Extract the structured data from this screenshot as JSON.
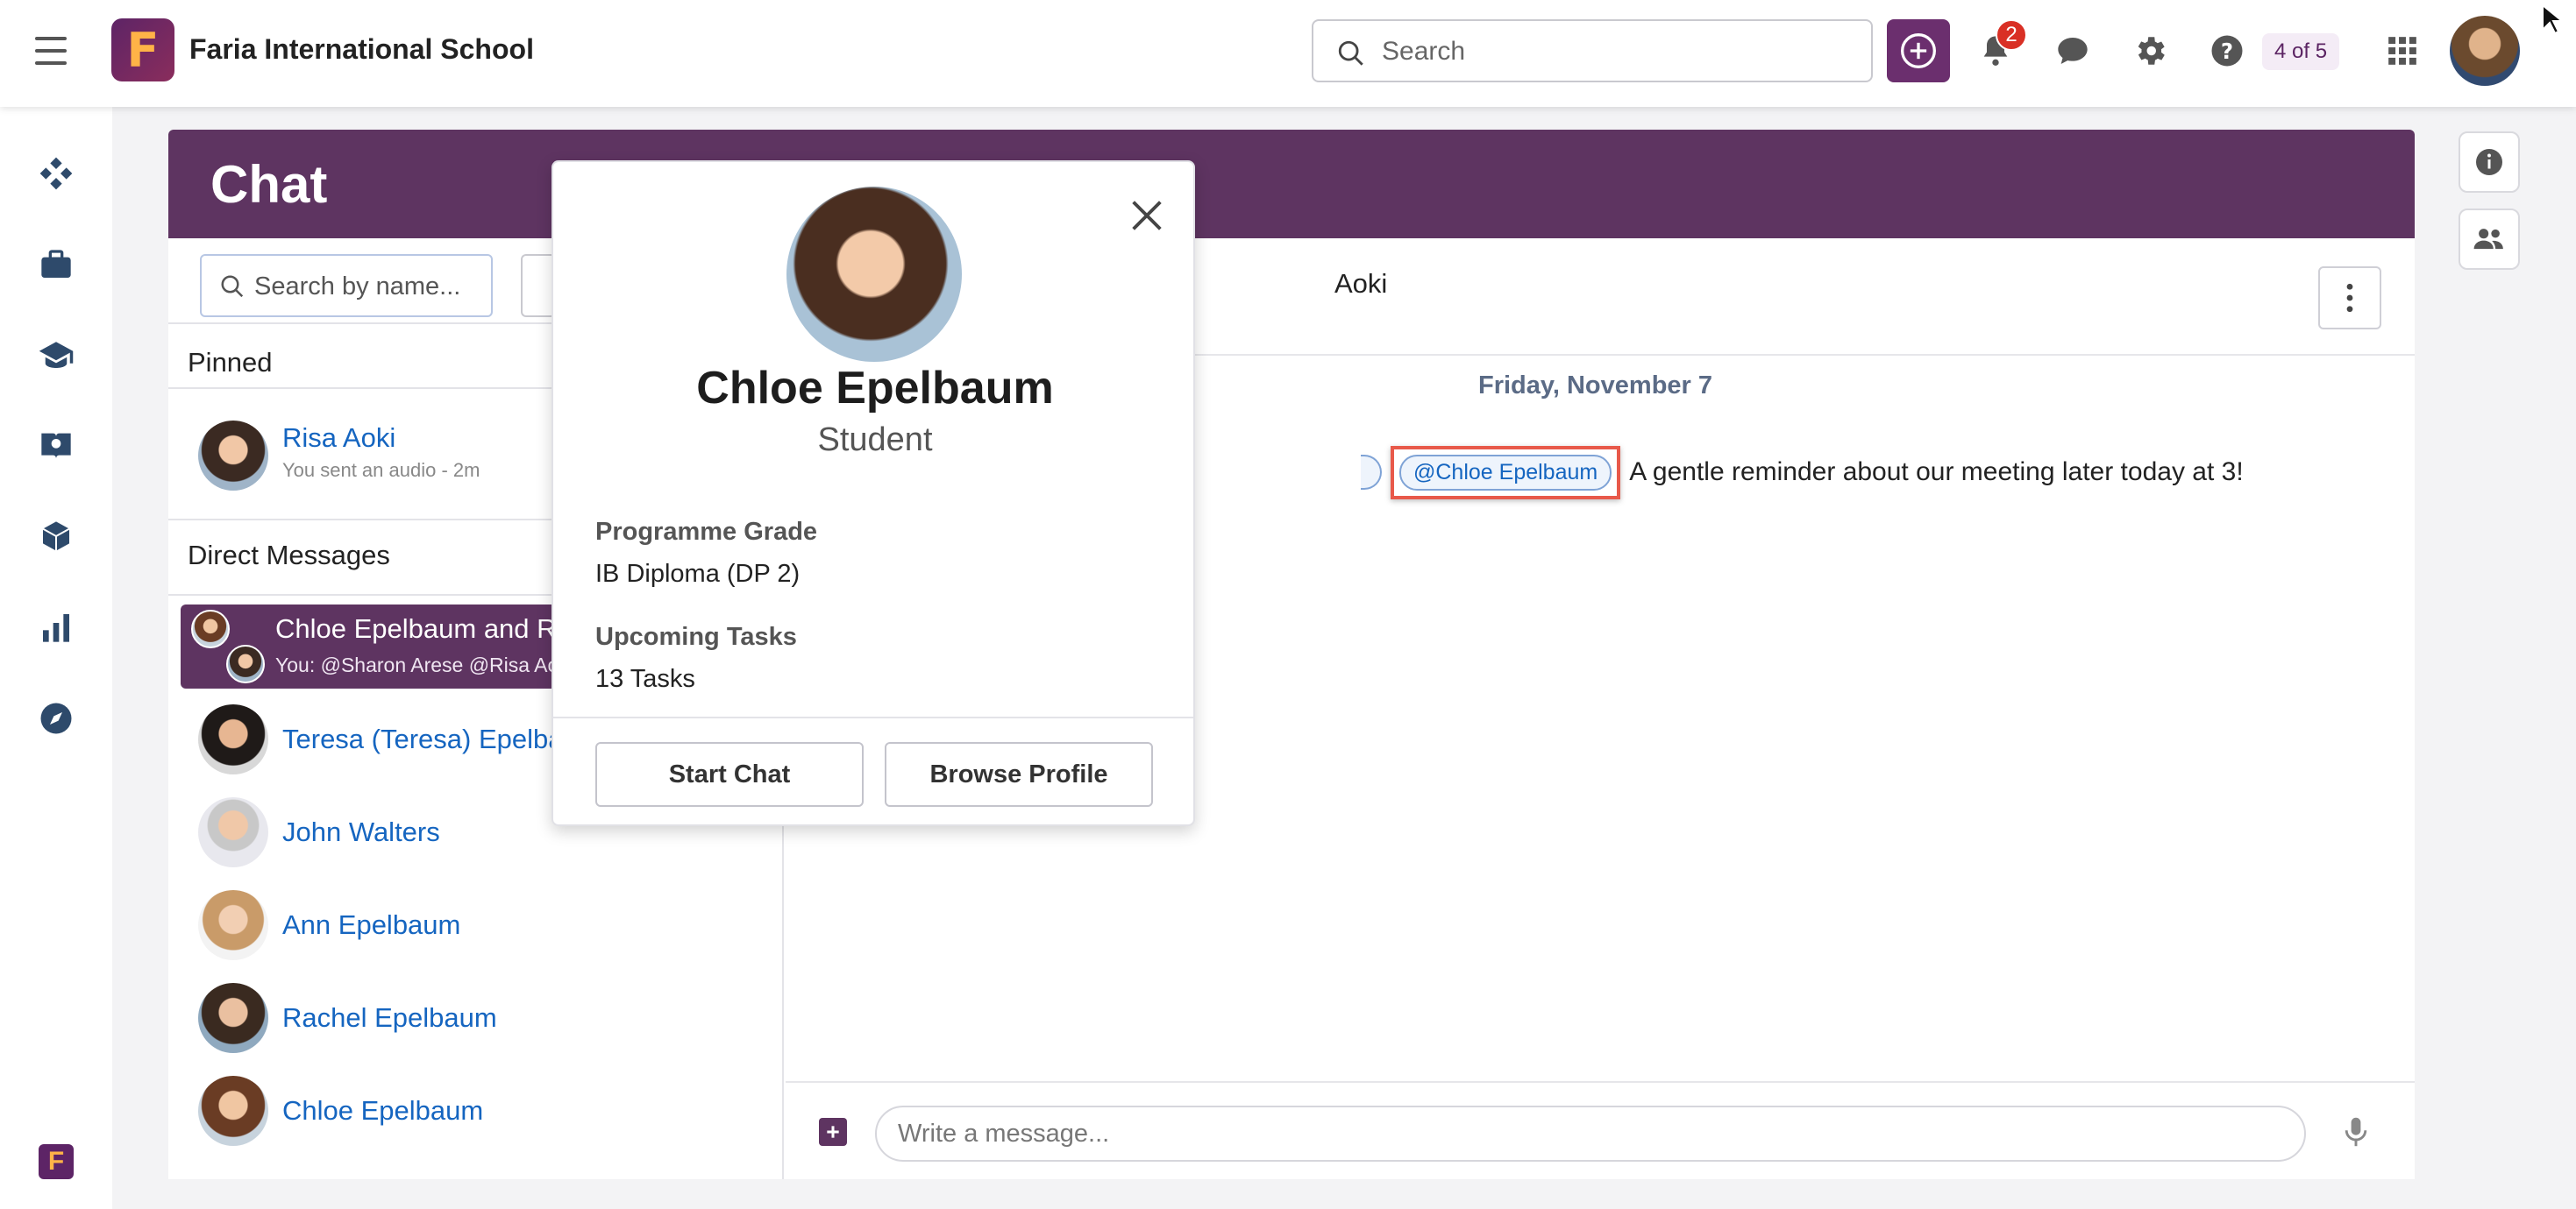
{
  "app": {
    "school_name": "Faria International School",
    "logo_letter": "F"
  },
  "topbar": {
    "search_placeholder": "Search",
    "notification_count": "2",
    "pager": "4 of 5"
  },
  "chat": {
    "title": "Chat",
    "search_placeholder": "Search by name...",
    "pinned_title": "Pinned",
    "pinned": [
      {
        "name": "Risa Aoki",
        "preview": "You sent an audio",
        "time": "- 2m"
      }
    ],
    "dm_title": "Direct Messages",
    "active": {
      "name": "Chloe Epelbaum and R",
      "preview": "You: @Sharon Arese @Risa Ao"
    },
    "contacts": [
      {
        "name": "Teresa (Teresa) Epelba"
      },
      {
        "name": "John Walters"
      },
      {
        "name": "Ann Epelbaum"
      },
      {
        "name": "Rachel Epelbaum"
      },
      {
        "name": "Chloe Epelbaum"
      }
    ]
  },
  "conversation": {
    "header_name": "Aoki",
    "date": "Friday, November 7",
    "mention": "@Chloe Epelbaum",
    "message": "A gentle reminder about our meeting later today at 3!",
    "composer_placeholder": "Write a message..."
  },
  "profile": {
    "name": "Chloe Epelbaum",
    "role": "Student",
    "grade_label": "Programme Grade",
    "grade_value": "IB Diploma (DP 2)",
    "tasks_label": "Upcoming Tasks",
    "tasks_value": "13 Tasks",
    "start_chat": "Start Chat",
    "browse_profile": "Browse Profile"
  },
  "colors": {
    "brand": "#5e3461",
    "link": "#1565c0",
    "badge": "#d93025",
    "highlight": "#e8594a"
  }
}
